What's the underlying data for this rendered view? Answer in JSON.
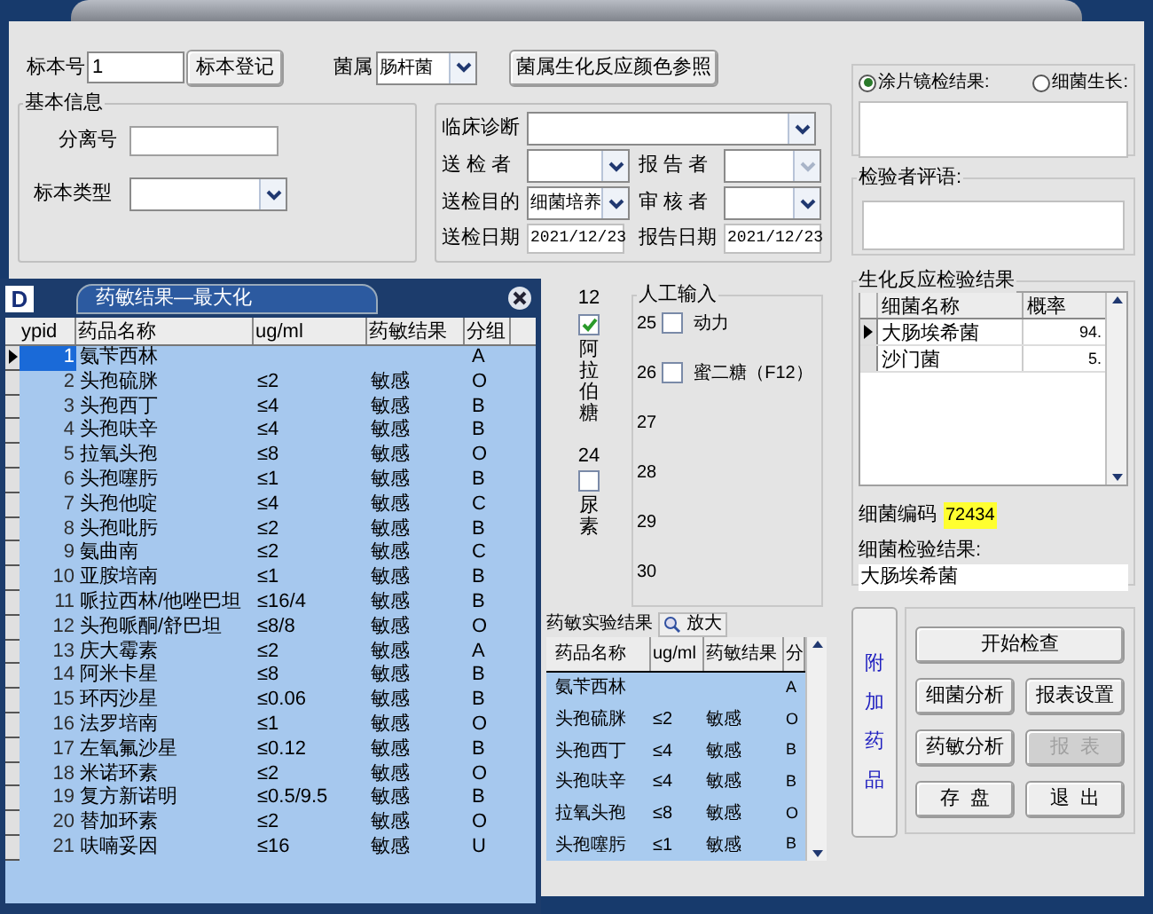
{
  "header": {
    "specimen_label": "标本号",
    "specimen_value": "1",
    "register_button": "标本登记",
    "genus_label": "菌属",
    "genus_value": "肠杆菌",
    "color_ref_button": "菌属生化反应颜色参照"
  },
  "basic_info": {
    "title": "基本信息",
    "isolate_label": "分离号",
    "type_label": "标本类型"
  },
  "clinical": {
    "diagnosis_label": "临床诊断",
    "sender_label": "送 检 者",
    "reporter_label": "报 告 者",
    "purpose_label": "送检目的",
    "purpose_value": "细菌培养",
    "reviewer_label": "审 核 者",
    "send_date_label": "送检日期",
    "send_date": "2021/12/23",
    "report_date_label": "报告日期",
    "report_date": "2021/12/23"
  },
  "side_checks": [
    {
      "number": "12",
      "label": "阿拉伯糖",
      "checked": true
    },
    {
      "number": "24",
      "label": "尿素",
      "checked": false
    }
  ],
  "manual_input": {
    "title": "人工输入",
    "items": [
      {
        "number": "25",
        "kind": "checkbox",
        "label": "动力",
        "checked": false
      },
      {
        "number": "26",
        "kind": "checkbox",
        "label": "蜜二糖（F12）",
        "checked": false
      },
      {
        "number": "27",
        "kind": "blank"
      },
      {
        "number": "28",
        "kind": "blank"
      },
      {
        "number": "29",
        "kind": "blank"
      },
      {
        "number": "30",
        "kind": "blank"
      }
    ]
  },
  "sensitivity": {
    "title": "药敏实验结果",
    "zoom_button": "放大",
    "columns": [
      "药品名称",
      "ug/ml",
      "药敏结果",
      "分"
    ],
    "rows": [
      [
        "氨苄西林",
        "",
        "",
        "A"
      ],
      [
        "头孢硫脒",
        "≤2",
        "敏感",
        "O"
      ],
      [
        "头孢西丁",
        "≤4",
        "敏感",
        "B"
      ],
      [
        "头孢呋辛",
        "≤4",
        "敏感",
        "B"
      ],
      [
        "拉氧头孢",
        "≤8",
        "敏感",
        "O"
      ],
      [
        "头孢噻肟",
        "≤1",
        "敏感",
        "B"
      ]
    ],
    "extra_button": "附加药品"
  },
  "smear": {
    "radios": [
      {
        "label": "涂片镜检结果:",
        "selected": true
      },
      {
        "label": "细菌生长:",
        "selected": false
      }
    ]
  },
  "comment": {
    "title": "检验者评语:"
  },
  "biochem": {
    "title": "生化反应检验结果",
    "columns": [
      "细菌名称",
      "概率"
    ],
    "rows": [
      {
        "name": "大肠埃希菌",
        "prob": "94.",
        "selected": true
      },
      {
        "name": "沙门菌",
        "prob": "5.",
        "selected": false
      }
    ],
    "code_label": "细菌编码",
    "code_value": "72434",
    "result_label": "细菌检验结果:",
    "result_value": "大肠埃希菌"
  },
  "actions": [
    {
      "label": "开始检查",
      "disabled": false
    },
    {
      "label": "细菌分析",
      "disabled": false
    },
    {
      "label": "报表设置",
      "disabled": false
    },
    {
      "label": "药敏分析",
      "disabled": false
    },
    {
      "label": "报  表",
      "disabled": true
    },
    {
      "label": "存  盘",
      "disabled": false
    },
    {
      "label": "退  出",
      "disabled": false
    }
  ],
  "popup": {
    "logo": "D",
    "title": "药敏结果—最大化",
    "columns": [
      "ypid",
      "药品名称",
      "ug/ml",
      "药敏结果",
      "分组"
    ],
    "rows": [
      {
        "id": "1",
        "name": "氨苄西林",
        "mic": "",
        "result": "",
        "group": "A",
        "selected": true
      },
      {
        "id": "2",
        "name": "头孢硫脒",
        "mic": "≤2",
        "result": "敏感",
        "group": "O",
        "selected": false
      },
      {
        "id": "3",
        "name": "头孢西丁",
        "mic": "≤4",
        "result": "敏感",
        "group": "B",
        "selected": false
      },
      {
        "id": "4",
        "name": "头孢呋辛",
        "mic": "≤4",
        "result": "敏感",
        "group": "B",
        "selected": false
      },
      {
        "id": "5",
        "name": "拉氧头孢",
        "mic": "≤8",
        "result": "敏感",
        "group": "O",
        "selected": false
      },
      {
        "id": "6",
        "name": "头孢噻肟",
        "mic": "≤1",
        "result": "敏感",
        "group": "B",
        "selected": false
      },
      {
        "id": "7",
        "name": "头孢他啶",
        "mic": "≤4",
        "result": "敏感",
        "group": "C",
        "selected": false
      },
      {
        "id": "8",
        "name": "头孢吡肟",
        "mic": "≤2",
        "result": "敏感",
        "group": "B",
        "selected": false
      },
      {
        "id": "9",
        "name": "氨曲南",
        "mic": "≤2",
        "result": "敏感",
        "group": "C",
        "selected": false
      },
      {
        "id": "10",
        "name": "亚胺培南",
        "mic": "≤1",
        "result": "敏感",
        "group": "B",
        "selected": false
      },
      {
        "id": "11",
        "name": "哌拉西林/他唑巴坦",
        "mic": "≤16/4",
        "result": "敏感",
        "group": "B",
        "selected": false
      },
      {
        "id": "12",
        "name": "头孢哌酮/舒巴坦",
        "mic": "≤8/8",
        "result": "敏感",
        "group": "O",
        "selected": false
      },
      {
        "id": "13",
        "name": "庆大霉素",
        "mic": "≤2",
        "result": "敏感",
        "group": "A",
        "selected": false
      },
      {
        "id": "14",
        "name": "阿米卡星",
        "mic": "≤8",
        "result": "敏感",
        "group": "B",
        "selected": false
      },
      {
        "id": "15",
        "name": "环丙沙星",
        "mic": "≤0.06",
        "result": "敏感",
        "group": "B",
        "selected": false
      },
      {
        "id": "16",
        "name": "法罗培南",
        "mic": "≤1",
        "result": "敏感",
        "group": "O",
        "selected": false
      },
      {
        "id": "17",
        "name": "左氧氟沙星",
        "mic": "≤0.12",
        "result": "敏感",
        "group": "B",
        "selected": false
      },
      {
        "id": "18",
        "name": "米诺环素",
        "mic": "≤2",
        "result": "敏感",
        "group": "O",
        "selected": false
      },
      {
        "id": "19",
        "name": "复方新诺明",
        "mic": "≤0.5/9.5",
        "result": "敏感",
        "group": "B",
        "selected": false
      },
      {
        "id": "20",
        "name": "替加环素",
        "mic": "≤2",
        "result": "敏感",
        "group": "O",
        "selected": false
      },
      {
        "id": "21",
        "name": "呋喃妥因",
        "mic": "≤16",
        "result": "敏感",
        "group": "U",
        "selected": false
      }
    ]
  }
}
